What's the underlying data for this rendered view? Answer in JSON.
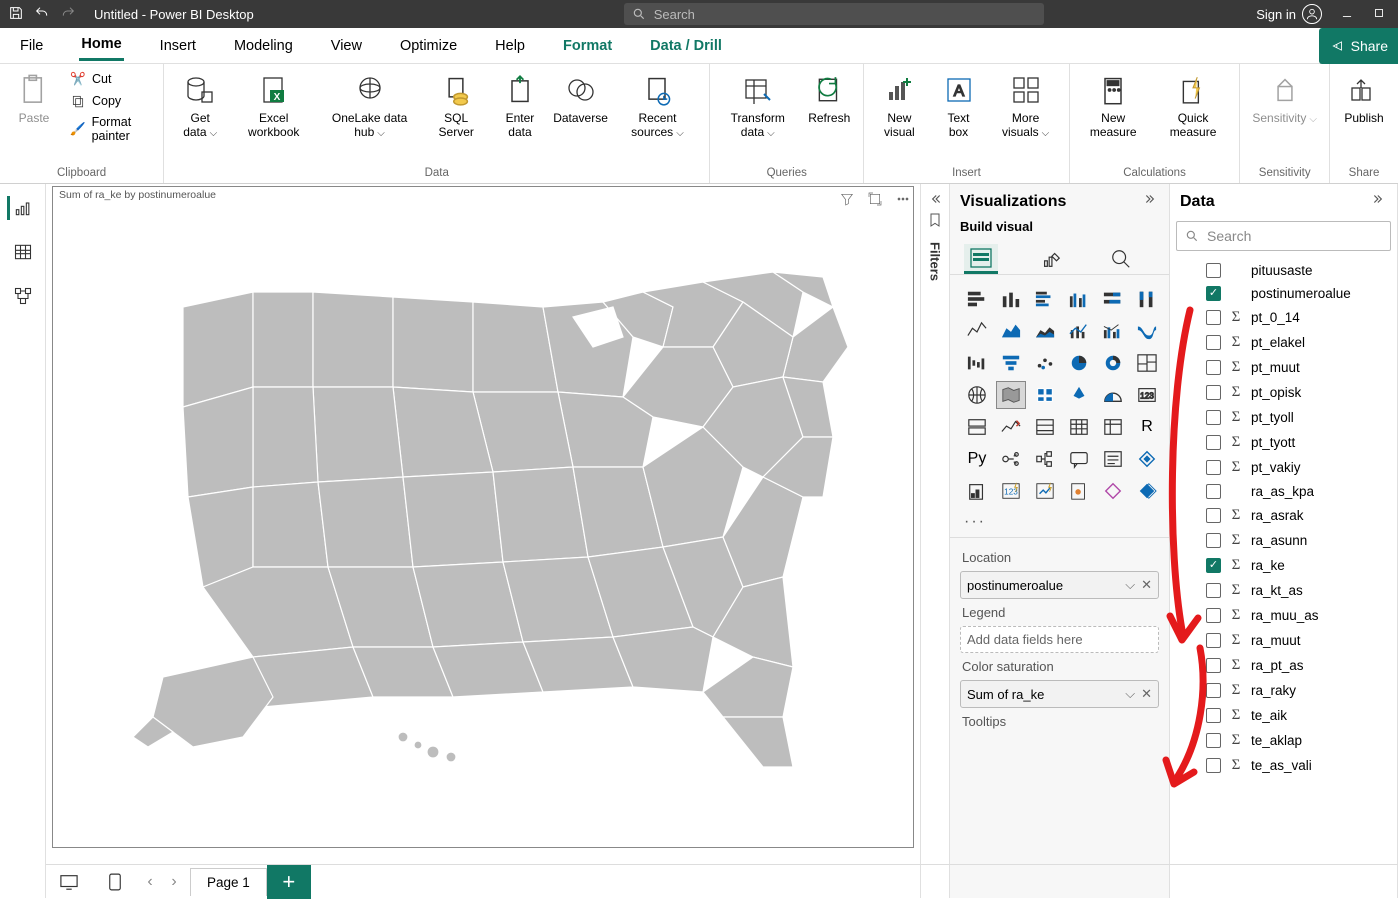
{
  "titlebar": {
    "title": "Untitled - Power BI Desktop",
    "search_placeholder": "Search",
    "signin": "Sign in"
  },
  "ribbon_tabs": {
    "file": "File",
    "home": "Home",
    "insert": "Insert",
    "modeling": "Modeling",
    "view": "View",
    "optimize": "Optimize",
    "help": "Help",
    "format": "Format",
    "datadrill": "Data / Drill",
    "share": "Share"
  },
  "ribbon": {
    "clipboard": {
      "label": "Clipboard",
      "paste": "Paste",
      "cut": "Cut",
      "copy": "Copy",
      "format_painter": "Format painter"
    },
    "data": {
      "label": "Data",
      "get_data": "Get data",
      "excel": "Excel workbook",
      "onelake": "OneLake data hub",
      "sql": "SQL Server",
      "enter_data": "Enter data",
      "dataverse": "Dataverse",
      "recent": "Recent sources"
    },
    "queries": {
      "label": "Queries",
      "transform": "Transform data",
      "refresh": "Refresh"
    },
    "insert": {
      "label": "Insert",
      "new_visual": "New visual",
      "text_box": "Text box",
      "more_visuals": "More visuals"
    },
    "calc": {
      "label": "Calculations",
      "new_measure": "New measure",
      "quick_measure": "Quick measure"
    },
    "sensitivity": {
      "label": "Sensitivity",
      "btn": "Sensitivity"
    },
    "share": {
      "label": "Share",
      "publish": "Publish"
    }
  },
  "canvas": {
    "viz_title": "Sum of ra_ke by postinumeroalue"
  },
  "filters_label": "Filters",
  "viz_pane": {
    "title": "Visualizations",
    "subtitle": "Build visual",
    "location_label": "Location",
    "location_value": "postinumeroalue",
    "legend_label": "Legend",
    "legend_placeholder": "Add data fields here",
    "colorsat_label": "Color saturation",
    "colorsat_value": "Sum of ra_ke",
    "tooltips_label": "Tooltips"
  },
  "data_pane": {
    "title": "Data",
    "search_placeholder": "Search",
    "fields": [
      {
        "name": "pituusaste",
        "sigma": false,
        "checked": false
      },
      {
        "name": "postinumeroalue",
        "sigma": false,
        "checked": true
      },
      {
        "name": "pt_0_14",
        "sigma": true,
        "checked": false
      },
      {
        "name": "pt_elakel",
        "sigma": true,
        "checked": false
      },
      {
        "name": "pt_muut",
        "sigma": true,
        "checked": false
      },
      {
        "name": "pt_opisk",
        "sigma": true,
        "checked": false
      },
      {
        "name": "pt_tyoll",
        "sigma": true,
        "checked": false
      },
      {
        "name": "pt_tyott",
        "sigma": true,
        "checked": false
      },
      {
        "name": "pt_vakiy",
        "sigma": true,
        "checked": false
      },
      {
        "name": "ra_as_kpa",
        "sigma": false,
        "checked": false
      },
      {
        "name": "ra_asrak",
        "sigma": true,
        "checked": false
      },
      {
        "name": "ra_asunn",
        "sigma": true,
        "checked": false
      },
      {
        "name": "ra_ke",
        "sigma": true,
        "checked": true
      },
      {
        "name": "ra_kt_as",
        "sigma": true,
        "checked": false
      },
      {
        "name": "ra_muu_as",
        "sigma": true,
        "checked": false
      },
      {
        "name": "ra_muut",
        "sigma": true,
        "checked": false
      },
      {
        "name": "ra_pt_as",
        "sigma": true,
        "checked": false
      },
      {
        "name": "ra_raky",
        "sigma": true,
        "checked": false
      },
      {
        "name": "te_aik",
        "sigma": true,
        "checked": false
      },
      {
        "name": "te_aklap",
        "sigma": true,
        "checked": false
      },
      {
        "name": "te_as_vali",
        "sigma": true,
        "checked": false
      }
    ]
  },
  "pager": {
    "page1": "Page 1"
  }
}
